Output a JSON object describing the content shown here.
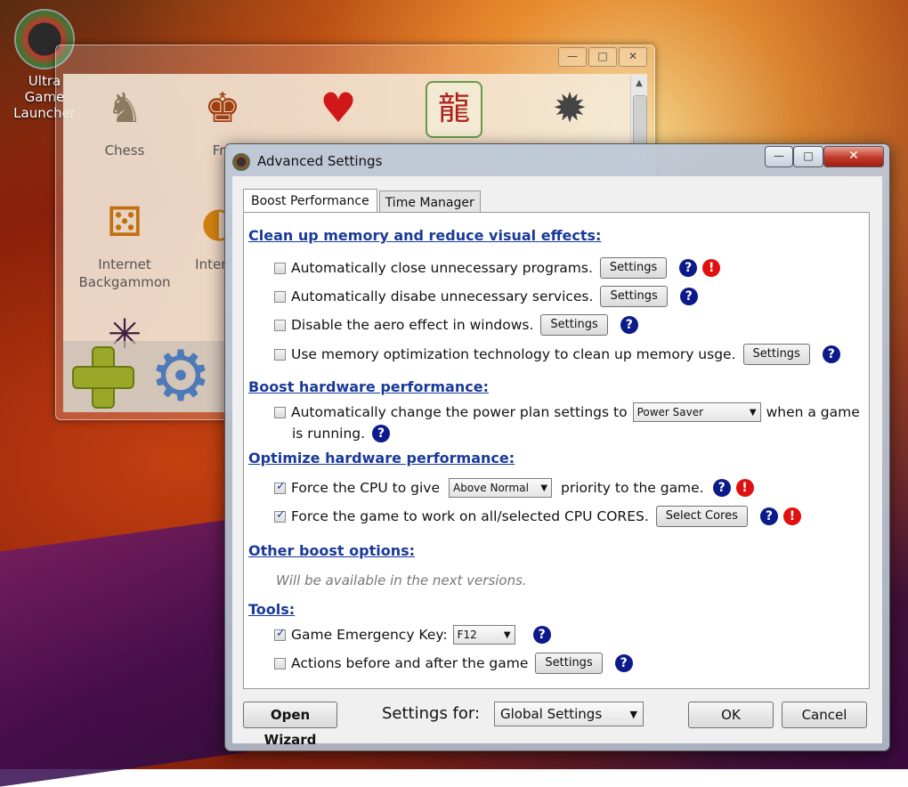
{
  "desktop": {
    "icon_label_line1": "Ultra Game",
    "icon_label_line2": "Launcher"
  },
  "launcher": {
    "games": [
      {
        "label": "Chess",
        "icon": "chess-icon"
      },
      {
        "label": "Fre",
        "icon": "card-icon"
      },
      {
        "label": "",
        "icon": "heart-icon"
      },
      {
        "label": "",
        "icon": "mahjong-icon"
      },
      {
        "label": "",
        "icon": "mine-icon"
      },
      {
        "label": "Internet Backgammon",
        "icon": "backgammon-icon"
      },
      {
        "label": "Interne",
        "icon": "internet-icon"
      },
      {
        "label": "",
        "icon": "spider-icon"
      }
    ],
    "window_controls": {
      "min": "—",
      "max": "□",
      "close": "✕"
    }
  },
  "dialog": {
    "title": "Advanced Settings",
    "controls": {
      "min": "—",
      "max": "□",
      "close": "✕"
    },
    "tabs": [
      {
        "label": "Boost Performance",
        "active": true
      },
      {
        "label": "Time Manager",
        "active": false
      }
    ],
    "sections": {
      "memory": "Clean up memory and reduce visual effects:",
      "hardware": "Boost hardware performance:",
      "optimize": "Optimize hardware performance:",
      "other": "Other boost options:",
      "tools": "Tools:"
    },
    "options": {
      "close_programs": {
        "label": "Automatically close unnecessary programs.",
        "checked": false,
        "button": "Settings"
      },
      "disable_services": {
        "label": "Automatically disabe unnecessary services.",
        "checked": false,
        "button": "Settings"
      },
      "disable_aero": {
        "label": "Disable the aero effect in windows.",
        "checked": false,
        "button": "Settings"
      },
      "memory_tech": {
        "label": "Use memory optimization technology to clean up memory usge.",
        "checked": false,
        "button": "Settings"
      },
      "power_plan": {
        "label_before": "Automatically change the power plan settings to",
        "select": "Power Saver",
        "label_after": "when a game",
        "label_line2": "is running.",
        "checked": false
      },
      "cpu_priority": {
        "label_before": "Force the CPU  to give",
        "select": "Above Normal",
        "label_after": "priority to the game.",
        "checked": true
      },
      "cpu_cores": {
        "label": "Force the game to work on all/selected CPU CORES.",
        "button": "Select Cores",
        "checked": true
      },
      "other_note": "Will be available in the next versions.",
      "emergency_key": {
        "label": "Game Emergency Key:",
        "select": "F12",
        "checked": true
      },
      "actions": {
        "label": "Actions before and after the game",
        "button": "Settings",
        "checked": false
      }
    },
    "help_glyph": "?",
    "warn_glyph": "!",
    "footer": {
      "open_wizard": "Open Wizard",
      "settings_for_label": "Settings for:",
      "settings_for_value": "Global Settings",
      "ok": "OK",
      "cancel": "Cancel"
    }
  }
}
